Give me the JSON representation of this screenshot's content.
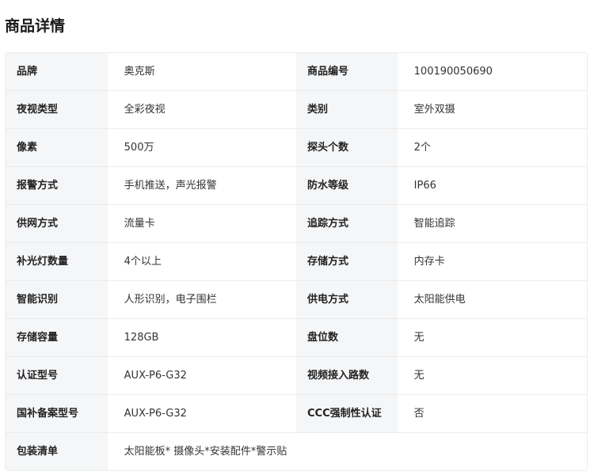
{
  "page": {
    "title": "商品详情"
  },
  "specs": {
    "rows": [
      {
        "left_label": "品牌",
        "left_value": "奥克斯",
        "right_label": "商品编号",
        "right_value": "100190050690"
      },
      {
        "left_label": "夜视类型",
        "left_value": "全彩夜视",
        "right_label": "类别",
        "right_value": "室外双摄"
      },
      {
        "left_label": "像素",
        "left_value": "500万",
        "right_label": "探头个数",
        "right_value": "2个"
      },
      {
        "left_label": "报警方式",
        "left_value": "手机推送，声光报警",
        "right_label": "防水等级",
        "right_value": "IP66"
      },
      {
        "left_label": "供网方式",
        "left_value": "流量卡",
        "right_label": "追踪方式",
        "right_value": "智能追踪"
      },
      {
        "left_label": "补光灯数量",
        "left_value": "4个以上",
        "right_label": "存储方式",
        "right_value": "内存卡"
      },
      {
        "left_label": "智能识别",
        "left_value": "人形识别，电子围栏",
        "right_label": "供电方式",
        "right_value": "太阳能供电"
      },
      {
        "left_label": "存储容量",
        "left_value": "128GB",
        "right_label": "盘位数",
        "right_value": "无"
      },
      {
        "left_label": "认证型号",
        "left_value": "AUX-P6-G32",
        "right_label": "视频接入路数",
        "right_value": "无"
      },
      {
        "left_label": "国补备案型号",
        "left_value": "AUX-P6-G32",
        "right_label": "CCC强制性认证",
        "right_value": "否"
      }
    ],
    "last_row": {
      "label": "包装清单",
      "value": "太阳能板* 摄像头*安装配件*警示贴"
    }
  }
}
